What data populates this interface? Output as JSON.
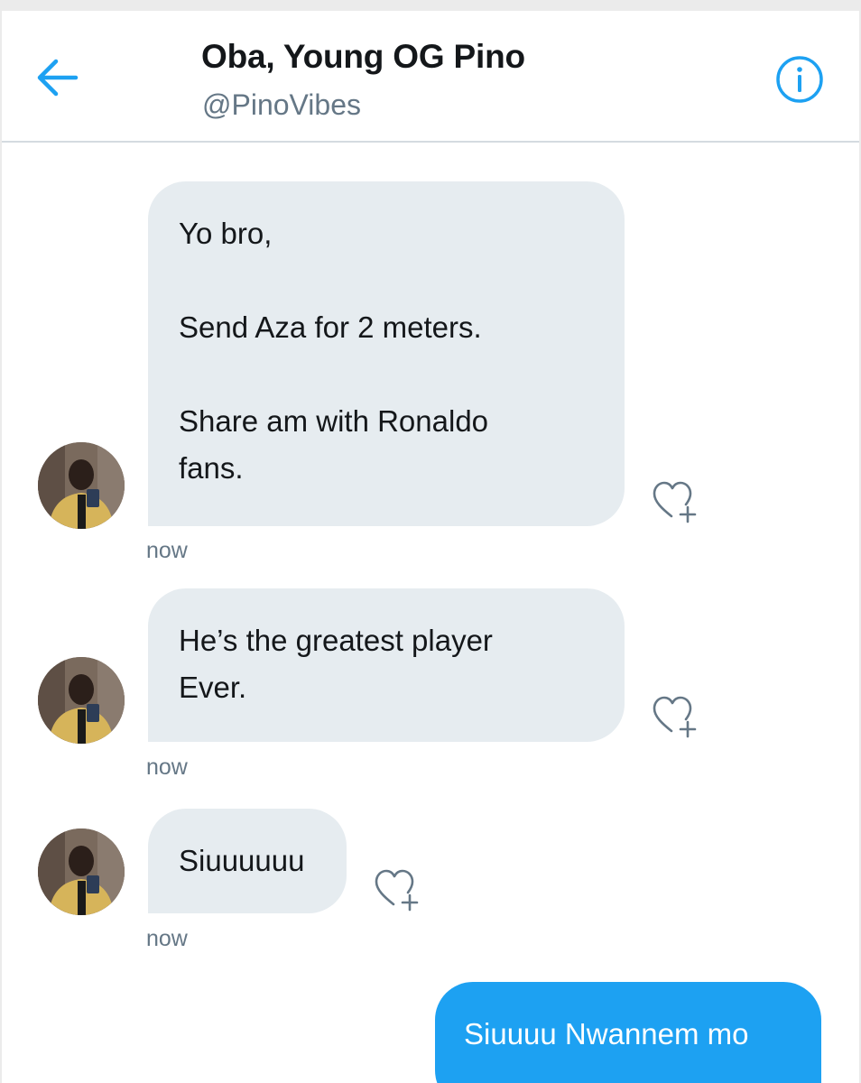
{
  "header": {
    "back_icon": "arrow-left-icon",
    "title": "Oba, Young OG Pino",
    "handle": "@PinoVibes",
    "info_icon": "info-circle-icon"
  },
  "colors": {
    "accent": "#1da1f2",
    "incoming_bubble": "#e6ecf0",
    "secondary_text": "#657786",
    "primary_text": "#14171a"
  },
  "messages": [
    {
      "direction": "incoming",
      "lines": [
        "Yo bro,",
        "",
        "Send Aza for 2 meters.",
        "",
        "Share am with Ronaldo",
        "fans."
      ],
      "timestamp": "now",
      "like_icon": "heart-plus-icon"
    },
    {
      "direction": "incoming",
      "lines": [
        "He’s the greatest player",
        "Ever."
      ],
      "timestamp": "now",
      "like_icon": "heart-plus-icon"
    },
    {
      "direction": "incoming",
      "lines": [
        "Siuuuuuu"
      ],
      "timestamp": "now",
      "like_icon": "heart-plus-icon"
    },
    {
      "direction": "outgoing",
      "lines": [
        "Siuuuu Nwannem mo"
      ]
    }
  ]
}
